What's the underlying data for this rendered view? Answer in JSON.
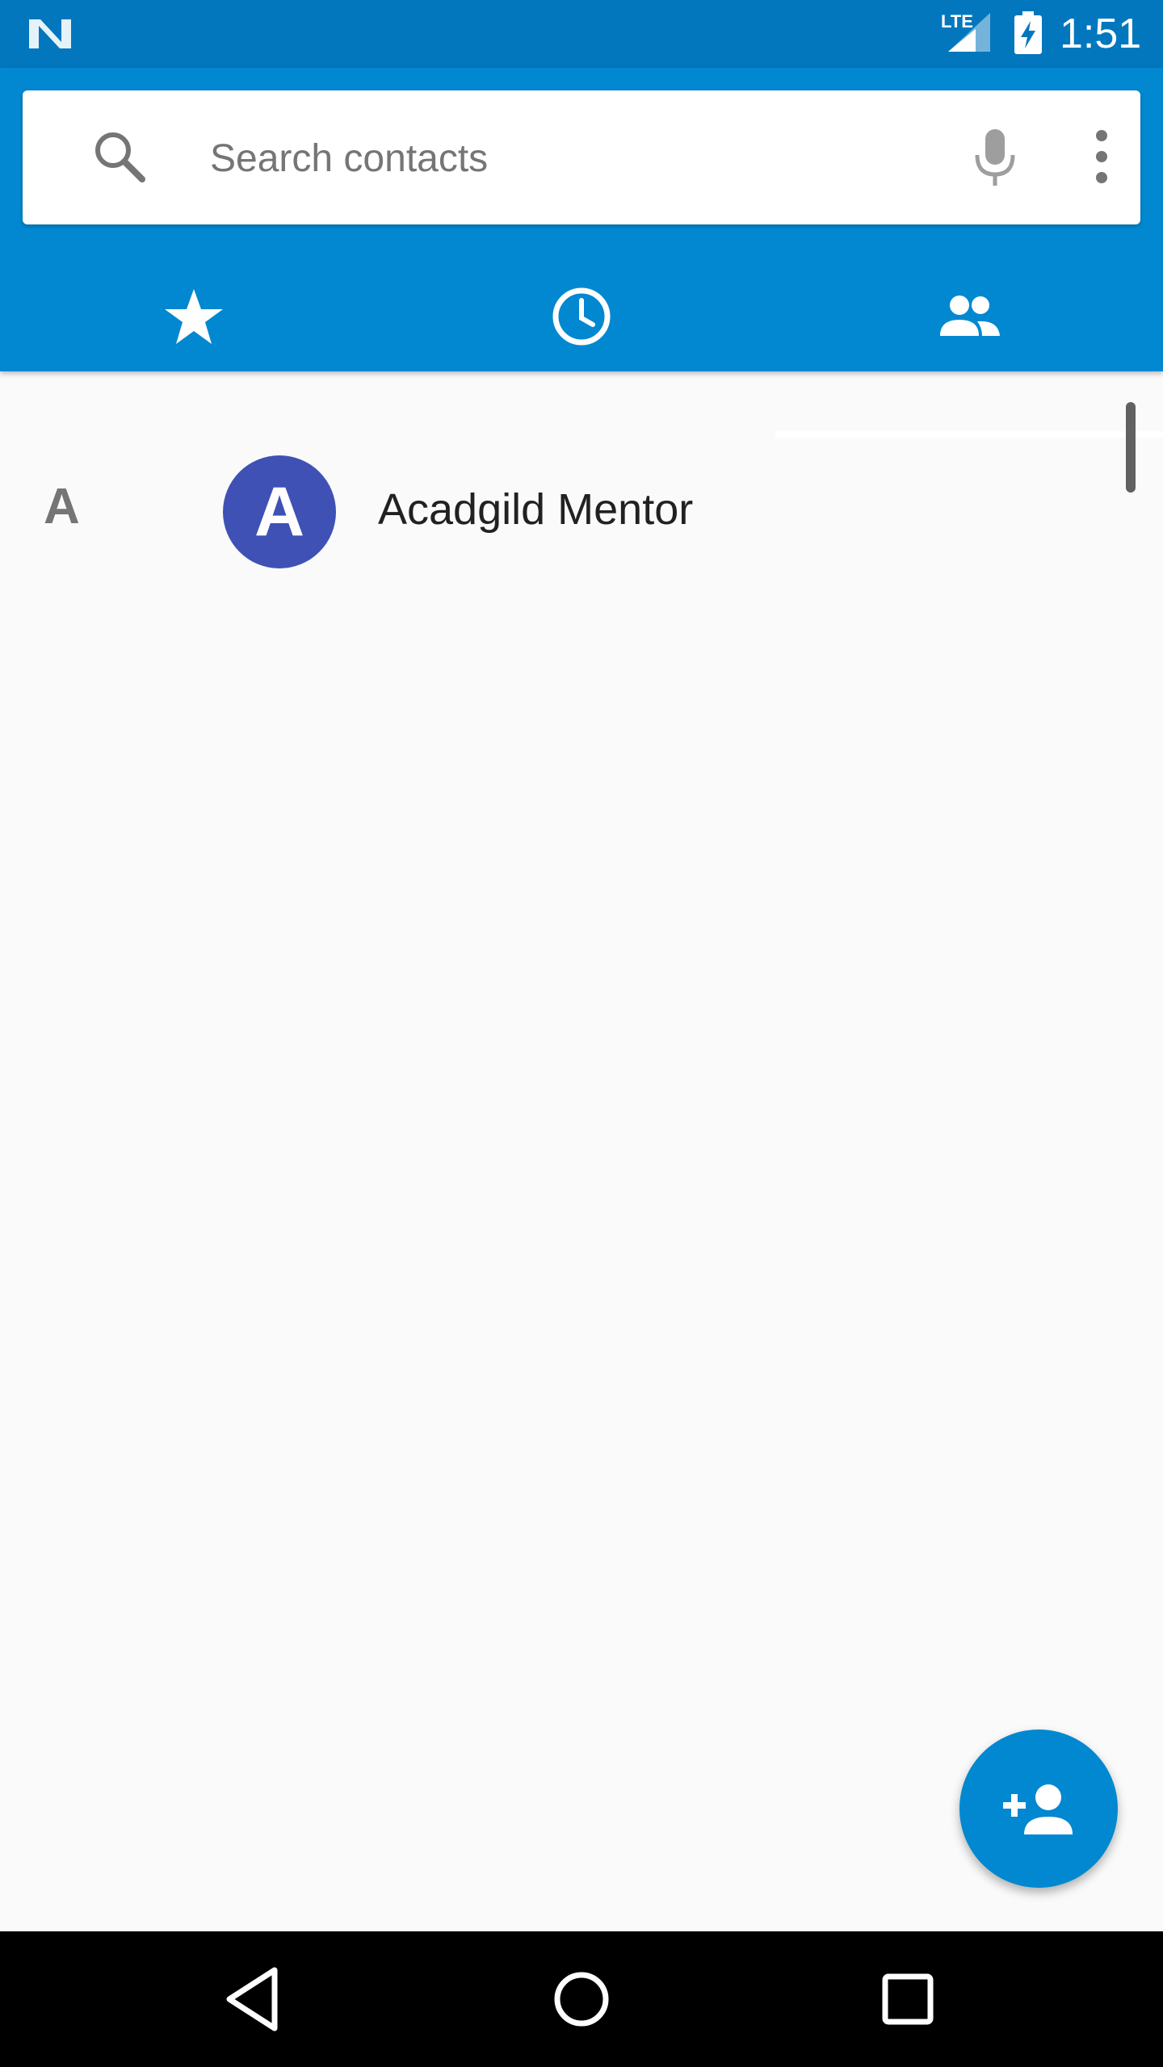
{
  "status_bar": {
    "network_label": "LTE",
    "time": "1:51",
    "icons": [
      "n-logo-icon",
      "signal-icon",
      "battery-charging-icon"
    ]
  },
  "search": {
    "placeholder": "Search contacts",
    "icons": [
      "search-icon",
      "mic-icon",
      "more-vert-icon"
    ]
  },
  "tabs": [
    {
      "icon": "star-icon",
      "selected": false
    },
    {
      "icon": "clock-icon",
      "selected": false
    },
    {
      "icon": "people-icon",
      "selected": true
    }
  ],
  "contacts": [
    {
      "section": "A",
      "initial": "A",
      "name": "Acadgild Mentor",
      "avatar_color": "#3f51b5"
    }
  ],
  "fab": {
    "icon": "add-person-icon"
  },
  "nav": {
    "icons": [
      "back-icon",
      "home-icon",
      "recents-icon"
    ]
  },
  "colors": {
    "status_bar": "#0277bd",
    "app_bar": "#0288d1",
    "background": "#fafafa",
    "fab": "#0288d1"
  }
}
